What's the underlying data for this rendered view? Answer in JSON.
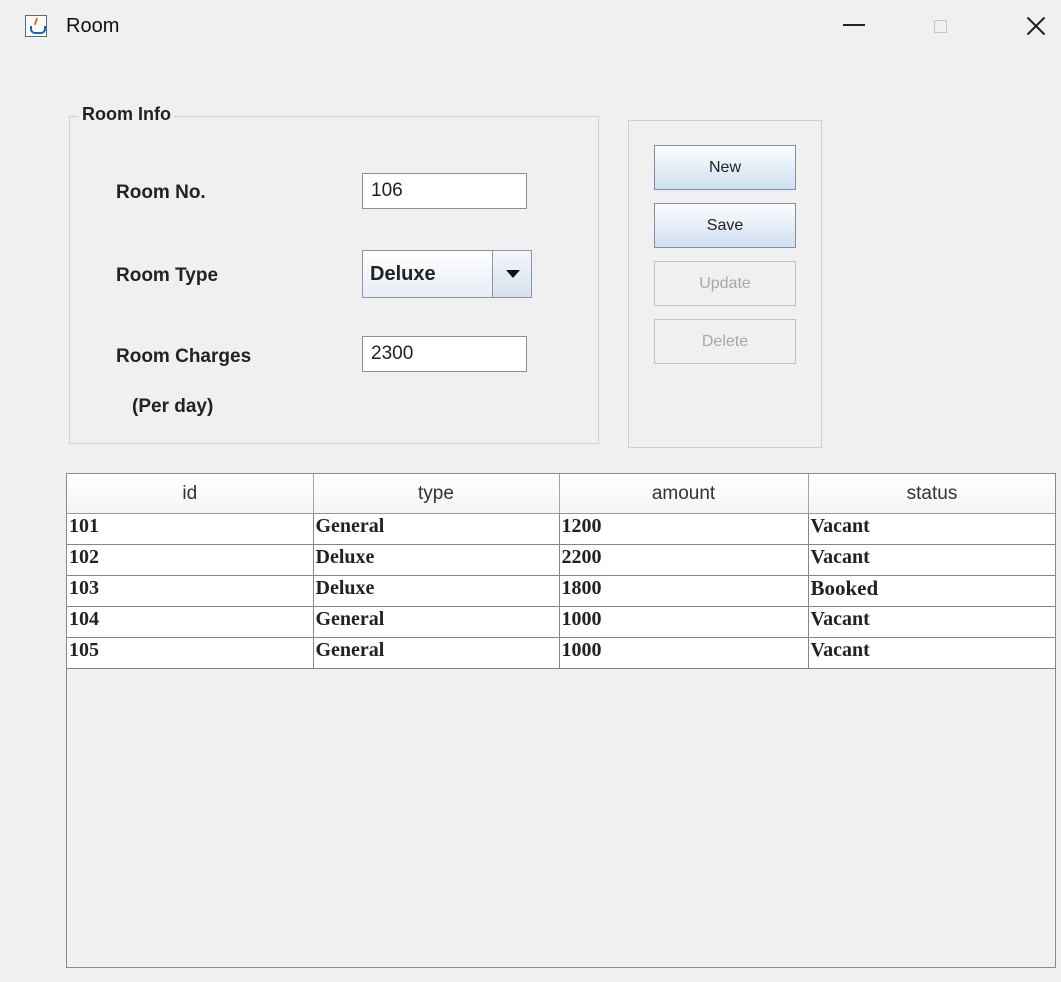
{
  "window": {
    "title": "Room",
    "icon": "java-icon",
    "controls": {
      "minimize_icon": "minimize-icon",
      "maximize_icon": "maximize-icon",
      "close_icon": "close-icon"
    }
  },
  "form": {
    "group_title": "Room Info",
    "room_no_label": "Room No.",
    "room_no_value": "106",
    "room_type_label": "Room Type",
    "room_type_value": "Deluxe",
    "room_charges_label": "Room Charges",
    "room_charges_sub_label": "(Per day)",
    "room_charges_value": "2300"
  },
  "buttons": {
    "new_label": "New",
    "save_label": "Save",
    "update_label": "Update",
    "delete_label": "Delete"
  },
  "table": {
    "columns": [
      "id",
      "type",
      "amount",
      "status"
    ],
    "rows": [
      {
        "id": "101",
        "type": "General",
        "amount": "1200",
        "status": "Vacant"
      },
      {
        "id": "102",
        "type": "Deluxe",
        "amount": "2200",
        "status": "Vacant"
      },
      {
        "id": "103",
        "type": "Deluxe",
        "amount": "1800",
        "status": "Booked"
      },
      {
        "id": "104",
        "type": "General",
        "amount": "1000",
        "status": "Vacant"
      },
      {
        "id": "105",
        "type": "General",
        "amount": "1000",
        "status": "Vacant"
      }
    ]
  }
}
